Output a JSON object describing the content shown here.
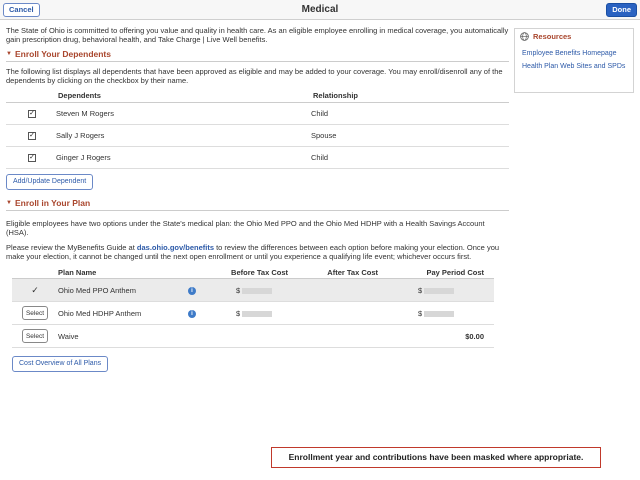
{
  "header": {
    "title": "Medical",
    "cancel_label": "Cancel",
    "done_label": "Done"
  },
  "intro": "The State of Ohio is committed to offering you value and quality in health care. As an eligible employee enrolling in medical coverage, you automatically gain prescription drug, behavioral health, and Take Charge | Live Well benefits.",
  "enroll_dependents": {
    "section_title": "Enroll Your Dependents",
    "description": "The following list displays all dependents that have been approved as eligible and may be added to your coverage. You may enroll/disenroll any of the dependents by clicking on the checkbox by their name.",
    "columns": [
      "Dependents",
      "Relationship"
    ],
    "rows": [
      {
        "name": "Steven M Rogers",
        "relationship": "Child",
        "checked": true
      },
      {
        "name": "Sally J Rogers",
        "relationship": "Spouse",
        "checked": true
      },
      {
        "name": "Ginger J Rogers",
        "relationship": "Child",
        "checked": true
      }
    ],
    "add_button": "Add/Update Dependent"
  },
  "enroll_plan": {
    "section_title": "Enroll in Your Plan",
    "para1": "Eligible employees have two options under the State's medical plan: the Ohio Med PPO and the Ohio Med HDHP with a Health Savings Account (HSA).",
    "para2_prefix": "Please review the MyBenefits Guide at ",
    "para2_link": "das.ohio.gov/benefits",
    "para2_suffix": " to review the differences between each option before making your election. Once you make your election, it cannot be changed until the next open enrollment or until you experience a qualifying life event; whichever occurs first.",
    "columns": {
      "plan": "Plan Name",
      "before_tax": "Before Tax Cost",
      "after_tax": "After Tax Cost",
      "pay_period": "Pay Period Cost"
    },
    "rows": [
      {
        "plan": "Ohio Med PPO Anthem",
        "selected": true,
        "action": "✓",
        "before_tax": "$",
        "pay_period": "$"
      },
      {
        "plan": "Ohio Med HDHP Anthem",
        "selected": false,
        "action": "Select",
        "before_tax": "$",
        "pay_period": "$"
      },
      {
        "plan": "Waive",
        "selected": false,
        "action": "Select",
        "before_tax": "",
        "pay_period": "$0.00"
      }
    ],
    "cost_button": "Cost Overview of All Plans"
  },
  "resources": {
    "title": "Resources",
    "links": [
      "Employee Benefits Homepage",
      "Health Plan Web Sites and SPDs"
    ]
  },
  "notice": "Enrollment year and contributions have been masked where appropriate.",
  "colors": {
    "section_heading": "#a9462d",
    "link": "#2d5aa8",
    "done_button": "#2a62c1",
    "notice_border": "#c0392b"
  }
}
